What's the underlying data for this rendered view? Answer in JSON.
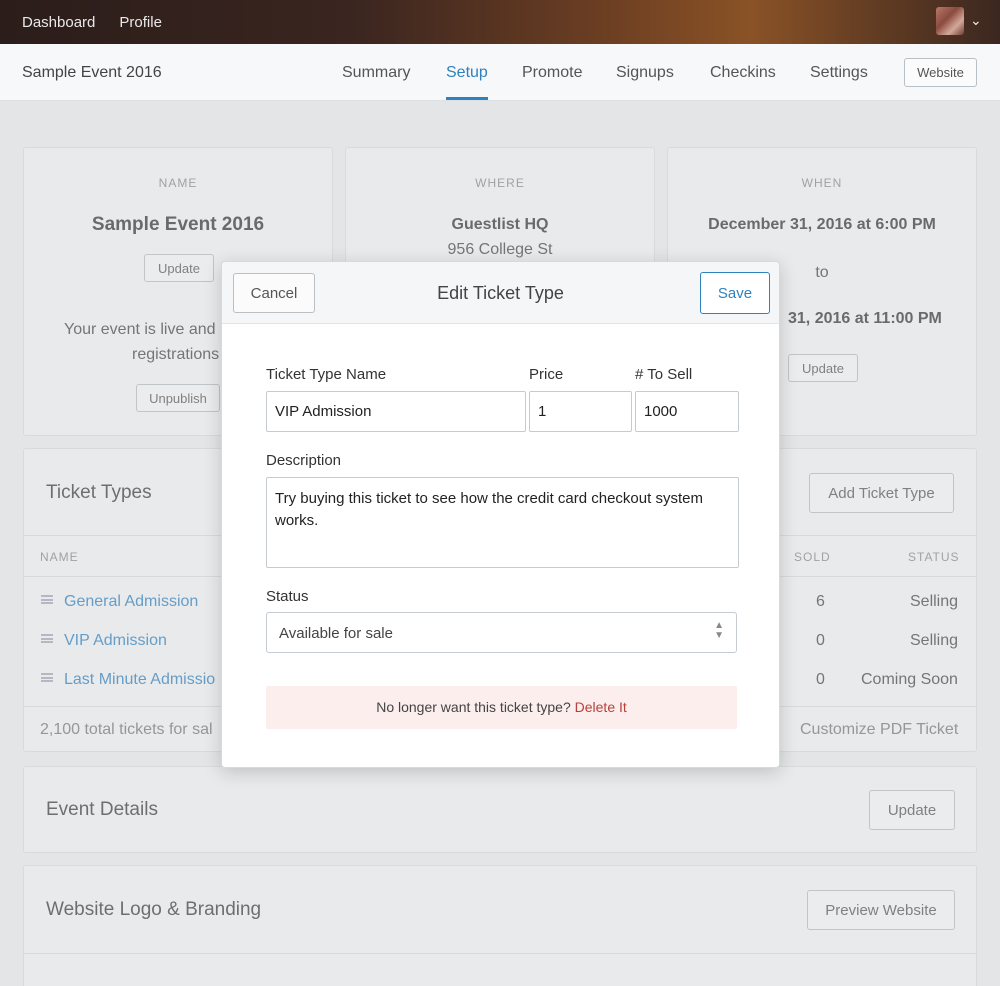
{
  "topbar": {
    "nav": [
      "Dashboard",
      "Profile"
    ],
    "caret": "⌄"
  },
  "subnav": {
    "event_title": "Sample Event 2016",
    "tabs": [
      "Summary",
      "Setup",
      "Promote",
      "Signups",
      "Checkins",
      "Settings"
    ],
    "active_tab": "Setup",
    "website_button": "Website"
  },
  "cards": {
    "name": {
      "caption": "NAME",
      "value": "Sample Event 2016",
      "button": "Update",
      "live_text_1": "Your event is live and",
      "live_text_2": "registrations",
      "unpublish": "Unpublish"
    },
    "where": {
      "caption": "WHERE",
      "line1": "Guestlist HQ",
      "line2": "956 College St"
    },
    "when": {
      "caption": "WHEN",
      "start": "December 31, 2016 at 6:00 PM",
      "to": "to",
      "end": "31, 2016 at 11:00 PM",
      "button": "Update"
    }
  },
  "ticket_types": {
    "title": "Ticket Types",
    "add_button": "Add Ticket Type",
    "headers": {
      "name": "NAME",
      "sold": "SOLD",
      "status": "STATUS"
    },
    "rows": [
      {
        "name": "General Admission",
        "sold": "6",
        "status": "Selling"
      },
      {
        "name": "VIP Admission",
        "sold": "0",
        "status": "Selling"
      },
      {
        "name": "Last Minute Admissio",
        "sold": "0",
        "status": "Coming Soon"
      }
    ],
    "footer_left": "2,100 total tickets for sal",
    "footer_right": "Customize PDF Ticket"
  },
  "event_details": {
    "title": "Event Details",
    "button": "Update"
  },
  "branding": {
    "title": "Website Logo & Branding",
    "button": "Preview Website"
  },
  "modal": {
    "title": "Edit Ticket Type",
    "cancel": "Cancel",
    "save": "Save",
    "labels": {
      "name": "Ticket Type Name",
      "price": "Price",
      "to_sell": "# To Sell",
      "description": "Description",
      "status": "Status"
    },
    "values": {
      "name": "VIP Admission",
      "price": "1",
      "to_sell": "1000",
      "description": "Try buying this ticket to see how the credit card checkout system works."
    },
    "status_value": "Available for sale",
    "delete_prompt": "No longer want this ticket type?",
    "delete_link": "Delete It"
  }
}
